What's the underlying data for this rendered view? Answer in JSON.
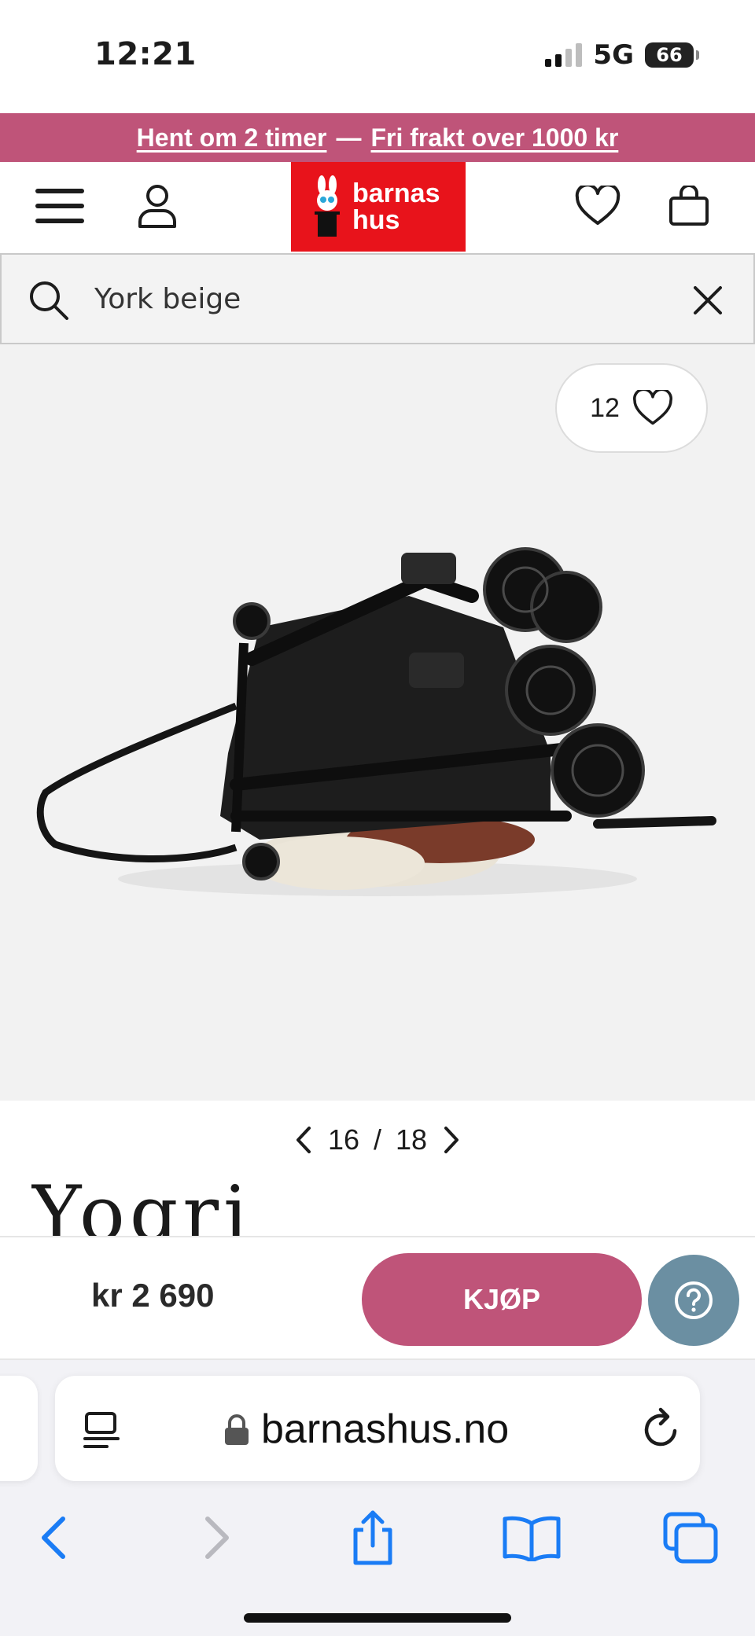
{
  "status_bar": {
    "time": "12:21",
    "network": "5G",
    "battery": "66"
  },
  "promo": {
    "pickup": "Hent om 2 timer",
    "separator": "—",
    "shipping": "Fri frakt over 1000 kr"
  },
  "header": {
    "logo_line1": "barnas",
    "logo_line2": "hus"
  },
  "search": {
    "value": "York beige"
  },
  "product": {
    "favorites_count": "12",
    "current_image": "16",
    "pager_separator": "/",
    "total_images": "18",
    "brand": "Yogri"
  },
  "buy_bar": {
    "price": "kr 2 690",
    "buy_label": "KJØP"
  },
  "browser": {
    "url": "barnashus.no"
  },
  "colors": {
    "accent": "#bf5479",
    "logo_red": "#e8131b",
    "help": "#6b8fa2",
    "safari_blue": "#1a7cf5"
  }
}
